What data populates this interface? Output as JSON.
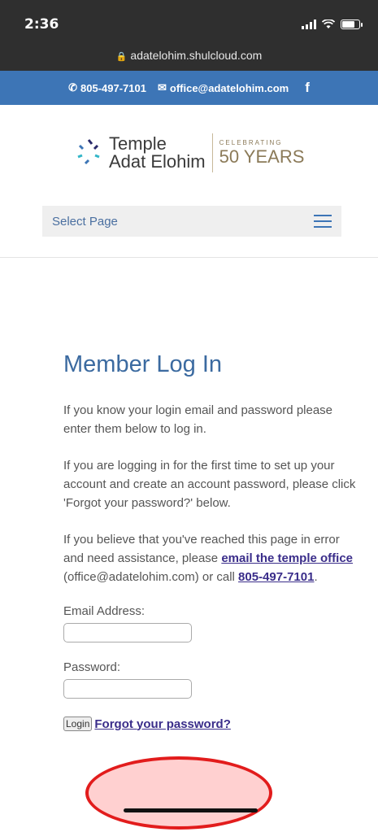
{
  "status": {
    "time": "2:36"
  },
  "browser": {
    "url": "adatelohim.shulcloud.com"
  },
  "contact": {
    "phone": "805-497-7101",
    "email": "office@adatelohim.com",
    "social": "f"
  },
  "logo": {
    "line1": "Temple",
    "line2": "Adat Elohim",
    "celebrating": "CELEBRATING",
    "years": "50 YEARS"
  },
  "nav": {
    "label": "Select Page"
  },
  "main": {
    "title": "Member Log In",
    "para1": "If you know your login email and password please enter them below to log in.",
    "para2": "If you are logging in for the first time to set up your account and create an account password, please click 'Forgot your password?' below.",
    "para3_before": "If you believe that you've reached this page in error and need assistance, please ",
    "para3_link": "email the temple office",
    "para3_mid": " (office@adatelohim.com) or call ",
    "para3_phone": "805-497-7101",
    "para3_end": "."
  },
  "form": {
    "email_label": "Email Address:",
    "email_value": "",
    "password_label": "Password:",
    "password_value": "",
    "login_label": "Login",
    "forgot_label": "Forgot your password?"
  },
  "colors": {
    "header_blue": "#3d75b6",
    "title_blue": "#3b6aa0",
    "link": "#3a2d8a",
    "annotation": "#e21c1c"
  }
}
